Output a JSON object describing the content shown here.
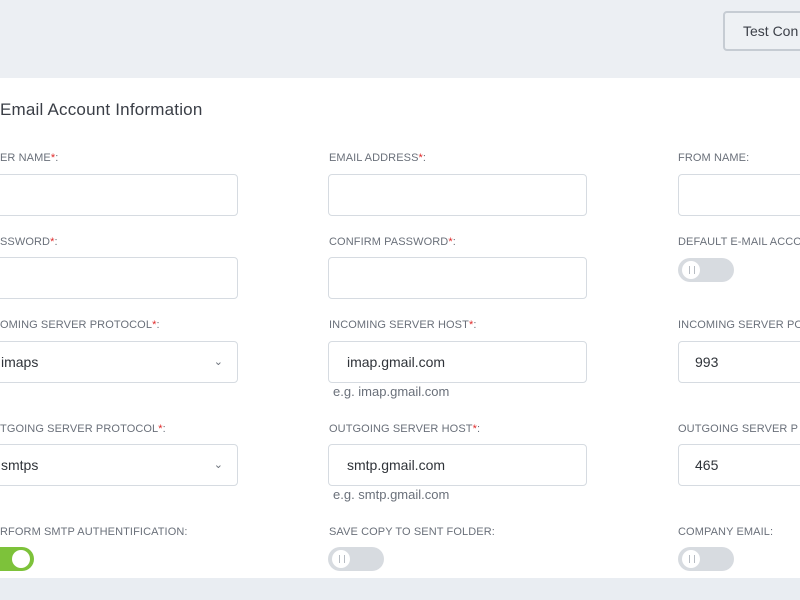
{
  "toolbar": {
    "test_button": "Test Con"
  },
  "section": {
    "title": "Email Account Information"
  },
  "col1": {
    "user_name_label": "ER NAME",
    "password_label": "SSWORD",
    "in_protocol_label": "OMING SERVER PROTOCOL",
    "in_protocol_value": "imaps",
    "out_protocol_label": "TGOING SERVER PROTOCOL",
    "out_protocol_value": "smtps",
    "smtp_auth_label": "RFORM SMTP AUTHENTIFICATION:"
  },
  "col2": {
    "email_label": "EMAIL ADDRESS",
    "confirm_label": "CONFIRM PASSWORD",
    "in_host_label": "INCOMING SERVER HOST",
    "in_host_value": "imap.gmail.com",
    "in_host_hint": "e.g. imap.gmail.com",
    "out_host_label": "OUTGOING SERVER HOST",
    "out_host_value": "smtp.gmail.com",
    "out_host_hint": "e.g. smtp.gmail.com",
    "save_copy_label": "SAVE COPY TO SENT FOLDER:"
  },
  "col3": {
    "from_name_label": "FROM NAME:",
    "default_label": "DEFAULT E-MAIL ACCO",
    "in_port_label": "INCOMING SERVER PO",
    "in_port_value": "993",
    "out_port_label": "OUTGOING SERVER P",
    "out_port_value": "465",
    "company_label": "COMPANY EMAIL:"
  },
  "required_mark": "*",
  "colon": ":",
  "toggles": {
    "smtp_auth": true,
    "save_copy": false,
    "default_account": false,
    "company_email": false
  },
  "colors": {
    "accent_green": "#7dc23a",
    "required_red": "#e02a2a"
  }
}
